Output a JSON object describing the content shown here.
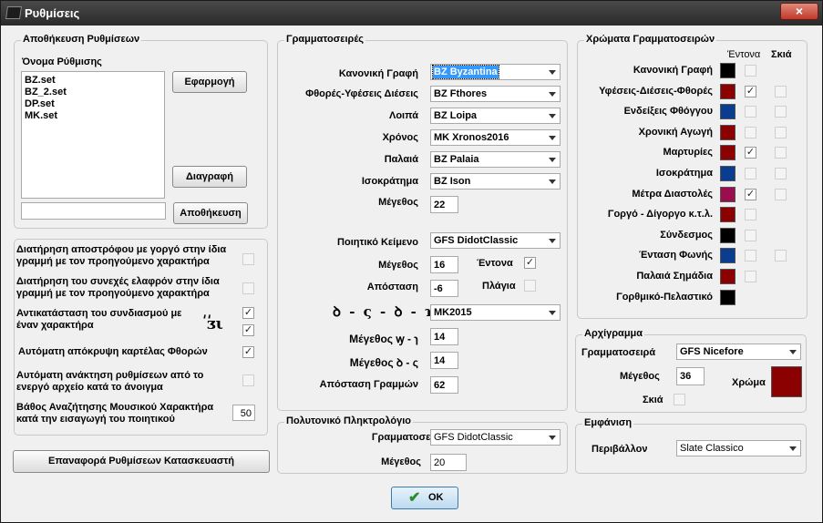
{
  "window": {
    "title": "Ρυθμίσεις",
    "close_glyph": "×"
  },
  "save_settings": {
    "legend": "Αποθήκευση Ρυθμίσεων",
    "name_label": "Όνομα Ρύθμισης",
    "files": [
      "BZ.set",
      "BZ_2.set",
      "DP.set",
      "MK.set"
    ],
    "apply_button": "Εφαρμογή",
    "delete_button": "Διαγραφή",
    "save_input_value": "",
    "save_button": "Αποθήκευση"
  },
  "options": {
    "keep_apostrophe": {
      "text": "Διατήρηση αποστρόφου με γοργό στην ίδια γραμμή με τον προηγούμενο χαρακτήρα",
      "checked": false
    },
    "keep_synechés": {
      "text": "Διατήρηση του συνεχές ελαφρόν στην ίδια γραμμή με τον προηγούμενο χαρακτήρα",
      "checked": false
    },
    "replace_combo": {
      "text": "Αντικατάσταση του συνδιασμού με έναν χαρακτήρα",
      "symbol_top": "͵͵",
      "symbol_bottom": "ᴣι",
      "checked_top": true,
      "checked_bottom": true
    },
    "auto_hide_tab": {
      "text": "Αυτόματη απόκρυψη καρτέλας Φθορών",
      "checked": true
    },
    "auto_load": {
      "text": "Αυτόματη ανάκτηση ρυθμίσεων από το ενεργό αρχείο κατά το άνοιγμα",
      "checked": false
    },
    "search_depth": {
      "text": "Βάθος Αναζήτησης Μουσικού Χαρακτήρα κατά την εισαγωγή του ποιητικού",
      "value": "50"
    }
  },
  "reset_button": "Επαναφορά Ρυθμίσεων  Κατασκευαστή",
  "fonts": {
    "legend": "Γραμματοσειρές",
    "rows": [
      {
        "label": "Κανονική Γραφή",
        "value": "BZ Byzantina"
      },
      {
        "label": "Φθορές-Υφέσεις Διέσεις",
        "value": "BZ Fthores"
      },
      {
        "label": "Λοιπά",
        "value": "BZ Loipa"
      },
      {
        "label": "Χρόνος",
        "value": "MK Xronos2016"
      },
      {
        "label": "Παλαιά",
        "value": "BZ Palaia"
      },
      {
        "label": "Ισοκράτημα",
        "value": "BZ Ison"
      }
    ],
    "size_label": "Μέγεθος",
    "size_value": "22",
    "poetic_label": "Ποιητικό Κείμενο",
    "poetic_value": "GFS DidotClassic",
    "poetic_size_label": "Μέγεθος",
    "poetic_size_value": "16",
    "bold_label": "Έντονα",
    "bold_checked": true,
    "distance_label": "Απόσταση",
    "distance_value": "-6",
    "italic_label": "Πλάγια",
    "italic_checked": false,
    "mk_symbols": "ꝺ - ς - ꝺ - ɿ",
    "mk_value": "MK2015",
    "size_a_label": "Μέγεθος  ꝡ - ɿ",
    "size_a_value": "14",
    "size_b_label": "Μέγεθος  ꝺ - ς",
    "size_b_value": "14",
    "line_distance_label": "Απόσταση Γραμμών",
    "line_distance_value": "62"
  },
  "keyboard": {
    "legend": "Πολυτονικό Πληκτρολόγιο",
    "font_label": "Γραμματοσειρά",
    "font_value": "GFS DidotClassic",
    "size_label": "Μέγεθος",
    "size_value": "20"
  },
  "font_colors": {
    "legend": "Χρώματα Γραμματοσειρών",
    "bold_header": "Έντονα",
    "shadow_header": "Σκιά",
    "rows": [
      {
        "label": "Κανονική Γραφή",
        "color": "#000000",
        "bold": false,
        "shadow": null
      },
      {
        "label": "Υφέσεις-Διέσεις-Φθορές",
        "color": "#8b0000",
        "bold": true,
        "shadow": false
      },
      {
        "label": "Ενδείξεις Φθόγγου",
        "color": "#0a3d8f",
        "bold": false,
        "shadow": false
      },
      {
        "label": "Χρονική Αγωγή",
        "color": "#8b0000",
        "bold": false,
        "shadow": false
      },
      {
        "label": "Μαρτυρίες",
        "color": "#8b0000",
        "bold": true,
        "shadow": false
      },
      {
        "label": "Ισοκράτημα",
        "color": "#0a3d8f",
        "bold": false,
        "shadow": false
      },
      {
        "label": "Μέτρα Διαστολές",
        "color": "#9b0d4d",
        "bold": true,
        "shadow": false
      },
      {
        "label": "Γοργό - Δίγοργο κ.τ.λ.",
        "color": "#8b0000",
        "bold": false,
        "shadow": null
      },
      {
        "label": "Σύνδεσμος",
        "color": "#000000",
        "bold": false,
        "shadow": null
      },
      {
        "label": "Ένταση Φωνής",
        "color": "#0a3d8f",
        "bold": false,
        "shadow": false
      },
      {
        "label": "Παλαιά Σημάδια",
        "color": "#8b0000",
        "bold": false,
        "shadow": null
      },
      {
        "label": "Γορθμικό-Πελαστικό",
        "color": "#000000",
        "bold": null,
        "shadow": null
      }
    ]
  },
  "initial": {
    "legend": "Αρχίγραμμα",
    "font_label": "Γραμματοσειρά",
    "font_value": "GFS Nicefore",
    "size_label": "Μέγεθος",
    "size_value": "36",
    "color_label": "Χρώμα",
    "color": "#8b0000",
    "shadow_label": "Σκιά",
    "shadow_checked": false
  },
  "appearance": {
    "legend": "Εμφάνιση",
    "env_label": "Περιβάλλον",
    "env_value": "Slate Classico"
  },
  "ok_button": "OK",
  "check_glyph": "✓"
}
